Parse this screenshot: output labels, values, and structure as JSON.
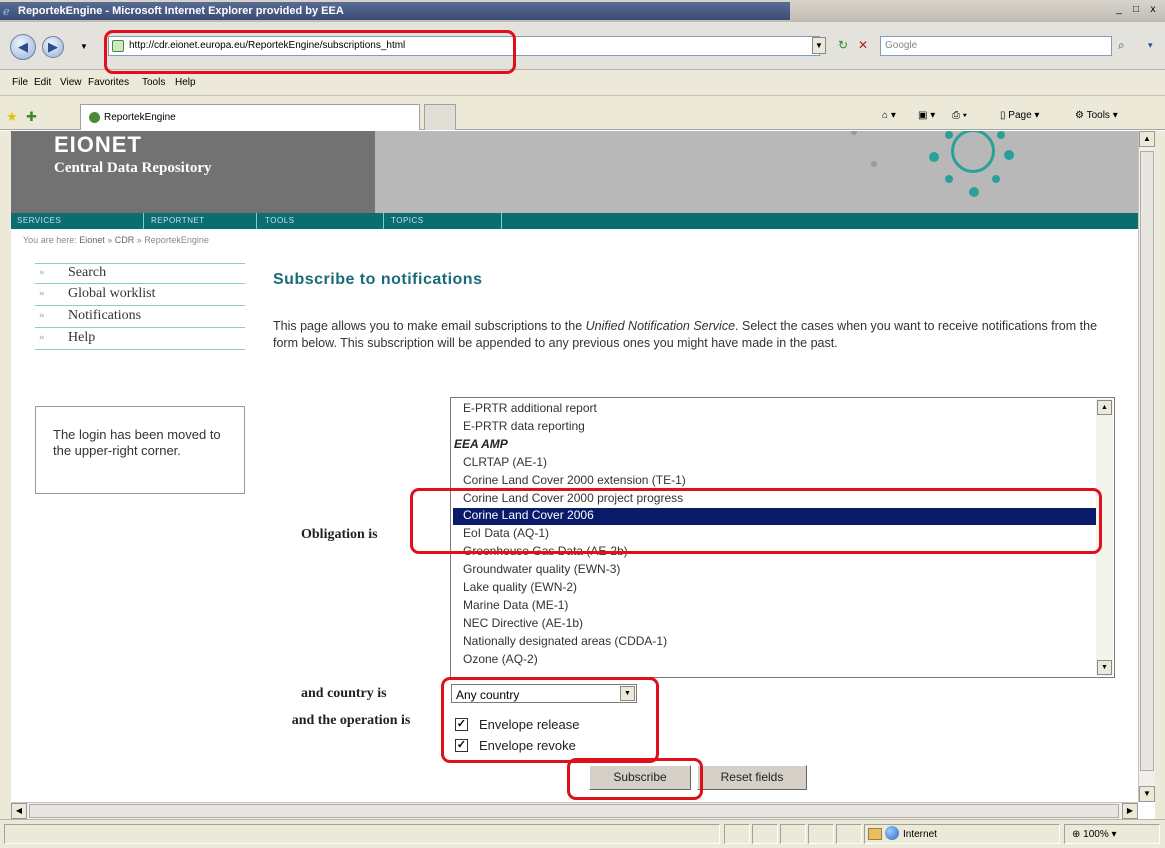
{
  "window": {
    "title": "ReportekEngine - Microsoft Internet Explorer provided by EEA",
    "buttons": [
      "_",
      "□",
      "x"
    ]
  },
  "addressbar": {
    "url": "http://cdr.eionet.europa.eu/ReportekEngine/subscriptions_html",
    "search_placeholder": "Google"
  },
  "menubar": [
    "File",
    "Edit",
    "View",
    "Favorites",
    "Tools",
    "Help"
  ],
  "tab": {
    "title": "ReportekEngine"
  },
  "commandbar": {
    "page": "Page",
    "tools": "Tools"
  },
  "statusbar": {
    "zone": "Internet",
    "zoom": "100%"
  },
  "site": {
    "name": "EIONET",
    "subtitle": "Central Data Repository",
    "nav": [
      "SERVICES",
      "REPORTNET",
      "TOOLS",
      "TOPICS"
    ],
    "breadcrumb_prefix": "You are here:",
    "breadcrumb": [
      "Eionet",
      "CDR",
      "ReportekEngine"
    ]
  },
  "sidebar": {
    "items": [
      "Search",
      "Global worklist",
      "Notifications",
      "Help"
    ],
    "login_note": "The login has been moved to the upper-right corner."
  },
  "page": {
    "title": "Subscribe to notifications",
    "intro_part1": "This page allows you to make email subscriptions to the ",
    "intro_service": "Unified Notification Service",
    "intro_part2": ". Select the cases when you want to receive notifications from the form below. This subscription will be appended to any previous ones you might have made in the past."
  },
  "form": {
    "obligation_label": "Obligation is",
    "obligation_options": [
      {
        "label": "E-PRTR additional report",
        "group": false,
        "selected": false
      },
      {
        "label": "E-PRTR data reporting",
        "group": false,
        "selected": false
      },
      {
        "label": "EEA AMP",
        "group": true,
        "selected": false
      },
      {
        "label": "CLRTAP (AE-1)",
        "group": false,
        "selected": false
      },
      {
        "label": "Corine Land Cover 2000 extension (TE-1)",
        "group": false,
        "selected": false
      },
      {
        "label": "Corine Land Cover 2000 project progress",
        "group": false,
        "selected": false
      },
      {
        "label": "Corine Land Cover 2006",
        "group": false,
        "selected": true
      },
      {
        "label": "EoI Data (AQ-1)",
        "group": false,
        "selected": false
      },
      {
        "label": "Greenhouse Gas Data (AE-2b)",
        "group": false,
        "selected": false
      },
      {
        "label": "Groundwater quality (EWN-3)",
        "group": false,
        "selected": false
      },
      {
        "label": "Lake quality (EWN-2)",
        "group": false,
        "selected": false
      },
      {
        "label": "Marine Data (ME-1)",
        "group": false,
        "selected": false
      },
      {
        "label": "NEC Directive (AE-1b)",
        "group": false,
        "selected": false
      },
      {
        "label": "Nationally designated areas (CDDA-1)",
        "group": false,
        "selected": false
      },
      {
        "label": "Ozone (AQ-2)",
        "group": false,
        "selected": false
      }
    ],
    "country_label": "and country is",
    "country_value": "Any country",
    "operation_label": "and the operation is",
    "operations": [
      {
        "label": "Envelope release",
        "checked": true
      },
      {
        "label": "Envelope revoke",
        "checked": true
      }
    ],
    "subscribe_button": "Subscribe",
    "reset_button": "Reset fields"
  },
  "colors": {
    "accent_teal": "#1a6a7a",
    "nav_bar": "#0a6e6e",
    "selected_option": "#0a1a6a",
    "annotation_red": "#e0101a"
  }
}
